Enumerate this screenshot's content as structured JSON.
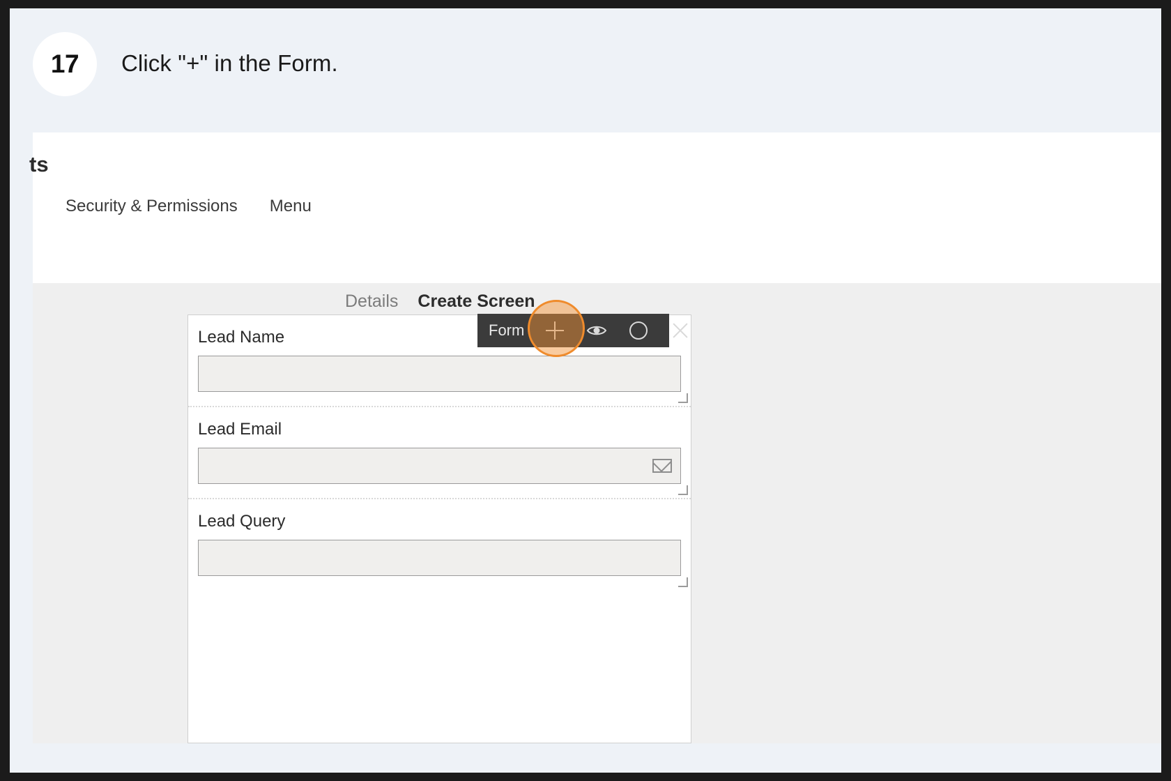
{
  "step": {
    "number": "17",
    "instruction": "Click \"+\" in the Form."
  },
  "app": {
    "title_clipped": "ts",
    "nav": [
      {
        "label": "Security & Permissions"
      },
      {
        "label": "Menu"
      }
    ]
  },
  "canvas": {
    "tabs": [
      {
        "label": "Details",
        "active": false
      },
      {
        "label": "Create Screen",
        "active": true
      }
    ]
  },
  "form": {
    "fields": [
      {
        "label": "Lead Name",
        "value": "",
        "icon": ""
      },
      {
        "label": "Lead Email",
        "value": "",
        "icon": "envelope-icon"
      },
      {
        "label": "Lead Query",
        "value": "",
        "icon": ""
      }
    ]
  },
  "toolbar": {
    "title": "Form",
    "actions": [
      {
        "name": "add-icon",
        "glyph": "plus"
      },
      {
        "name": "preview-icon",
        "glyph": "eye"
      },
      {
        "name": "status-icon",
        "glyph": "circle"
      },
      {
        "name": "close-icon",
        "glyph": "x"
      }
    ]
  },
  "highlight": {
    "target": "add-icon",
    "color": "#ef8b2c"
  }
}
